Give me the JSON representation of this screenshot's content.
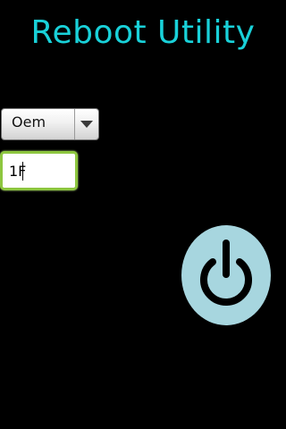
{
  "app": {
    "title": "Reboot Utility"
  },
  "spinner": {
    "selected": "Oem"
  },
  "input": {
    "value": "1F"
  },
  "power_button": {
    "icon": "power-icon"
  },
  "colors": {
    "background": "#000000",
    "title": "#19d1d9",
    "input_focus_border": "#8dc63f",
    "power_button": "#a7d6df"
  }
}
